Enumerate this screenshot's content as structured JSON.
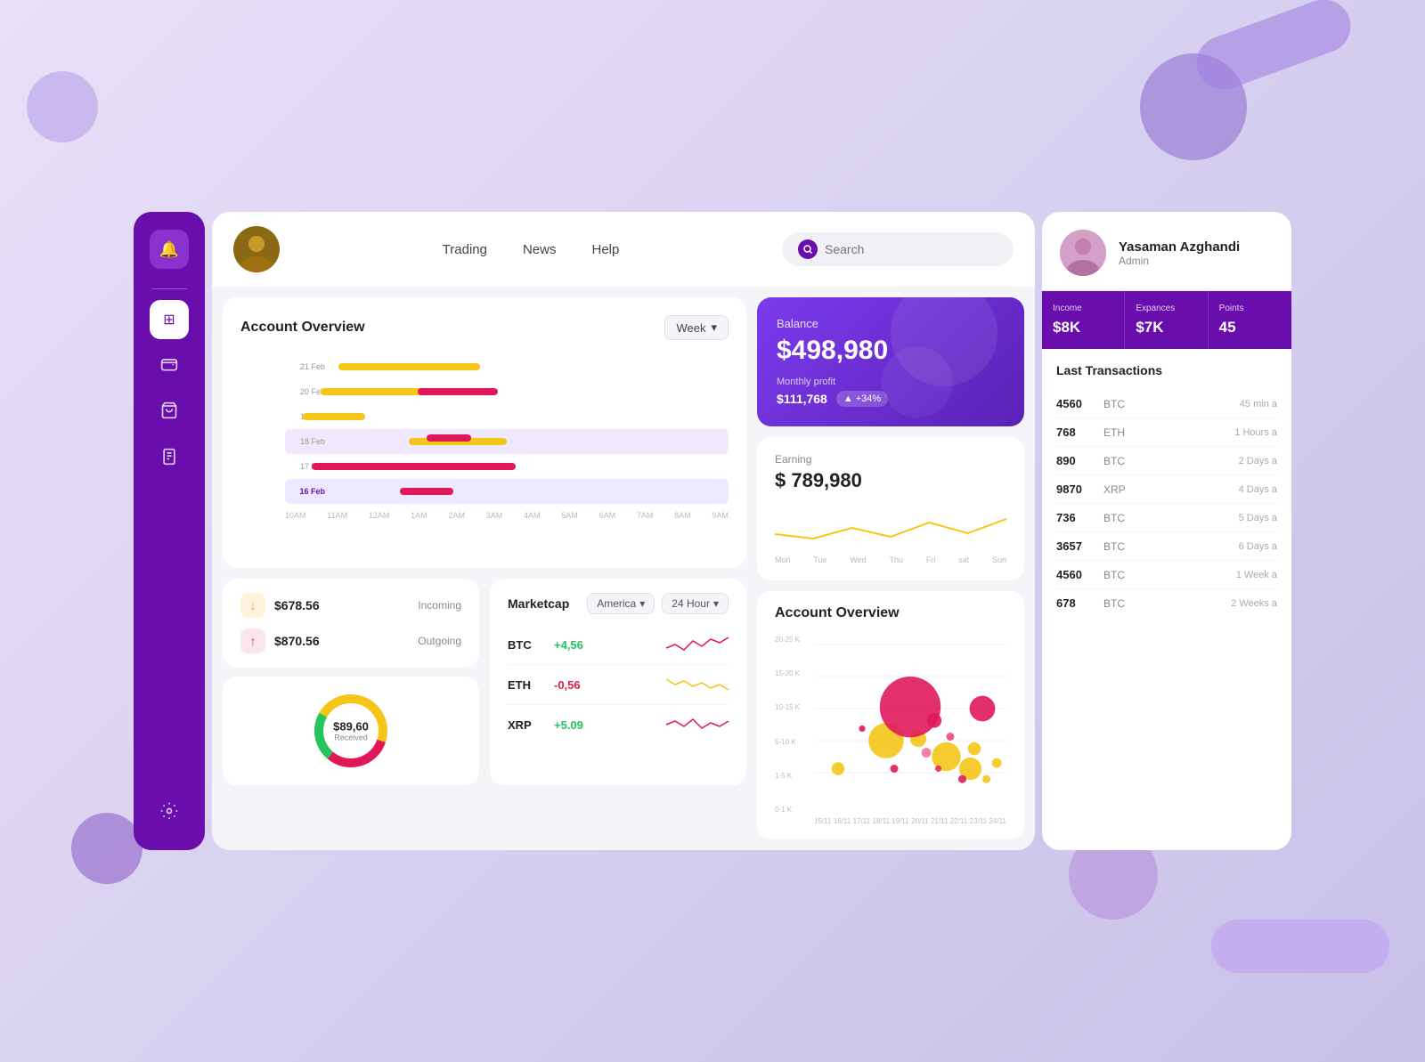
{
  "background": {
    "color": "#e8dff5"
  },
  "sidebar": {
    "items": [
      {
        "id": "bell",
        "icon": "🔔",
        "label": "Notifications",
        "active": false
      },
      {
        "id": "dashboard",
        "icon": "⊞",
        "label": "Dashboard",
        "active": true
      },
      {
        "id": "wallet",
        "icon": "💳",
        "label": "Wallet",
        "active": false
      },
      {
        "id": "shop",
        "icon": "🛍",
        "label": "Shop",
        "active": false
      },
      {
        "id": "reports",
        "icon": "📋",
        "label": "Reports",
        "active": false
      },
      {
        "id": "settings",
        "icon": "⚙",
        "label": "Settings",
        "active": false
      }
    ]
  },
  "header": {
    "nav": [
      {
        "label": "Trading"
      },
      {
        "label": "News"
      },
      {
        "label": "Help"
      }
    ],
    "search": {
      "placeholder": "Search"
    }
  },
  "account_overview": {
    "title": "Account Overview",
    "period": "Week",
    "dates": [
      "21 Feb",
      "20 Feb",
      "19 Feb",
      "18 Feb",
      "17 Feb",
      "16 Feb"
    ],
    "time_labels": [
      "10AM",
      "11AM",
      "12AM",
      "1AM",
      "2AM",
      "3AM",
      "4AM",
      "5AM",
      "6AM",
      "7AM",
      "8AM",
      "9AM"
    ]
  },
  "balance": {
    "label": "Balance",
    "amount": "$498,980",
    "monthly_profit_label": "Monthly profit",
    "monthly_profit": "$111,768",
    "profit_change": "+34%"
  },
  "earning": {
    "label": "Earning",
    "amount": "$ 789,980",
    "days": [
      "Mon",
      "Tue",
      "Wed",
      "Thu",
      "Fri",
      "sat",
      "Sun"
    ]
  },
  "transactions_mini": {
    "incoming_label": "Incoming",
    "incoming_amount": "$678.56",
    "outgoing_label": "Outgoing",
    "outgoing_amount": "$870.56",
    "donut": {
      "amount": "$89,60",
      "label": "Received"
    }
  },
  "marketcap": {
    "title": "Marketcap",
    "region": "America",
    "period": "24 Hour",
    "coins": [
      {
        "name": "BTC",
        "change": "+4,56",
        "positive": true
      },
      {
        "name": "ETH",
        "change": "-0,56",
        "positive": false
      },
      {
        "name": "XRP",
        "change": "+5.09",
        "positive": true
      }
    ]
  },
  "account_overview2": {
    "title": "Account Overview",
    "y_labels": [
      "20-25 K",
      "15-20 K",
      "10-15 K",
      "5-10 K",
      "1-5 K",
      "0-1 K"
    ],
    "x_labels": [
      "15/11",
      "16/11",
      "17/11",
      "18/11",
      "19/11",
      "20/11",
      "21/11",
      "22/11",
      "23/11",
      "24/11"
    ]
  },
  "right_panel": {
    "user": {
      "name": "Yasaman Azghandi",
      "role": "Admin"
    },
    "stats": [
      {
        "label": "Income",
        "value": "$8K"
      },
      {
        "label": "Expances",
        "value": "$7K"
      },
      {
        "label": "Points",
        "value": "45"
      }
    ],
    "transactions_title": "Last Transactions",
    "transactions": [
      {
        "amount": "4560",
        "coin": "BTC",
        "time": "45 min a"
      },
      {
        "amount": "768",
        "coin": "ETH",
        "time": "1 Hours a"
      },
      {
        "amount": "890",
        "coin": "BTC",
        "time": "2 Days a"
      },
      {
        "amount": "9870",
        "coin": "XRP",
        "time": "4 Days a"
      },
      {
        "amount": "736",
        "coin": "BTC",
        "time": "5 Days a"
      },
      {
        "amount": "3657",
        "coin": "BTC",
        "time": "6 Days a"
      },
      {
        "amount": "4560",
        "coin": "BTC",
        "time": "1 Week a"
      },
      {
        "amount": "678",
        "coin": "BTC",
        "time": "2 Weeks a"
      }
    ]
  }
}
